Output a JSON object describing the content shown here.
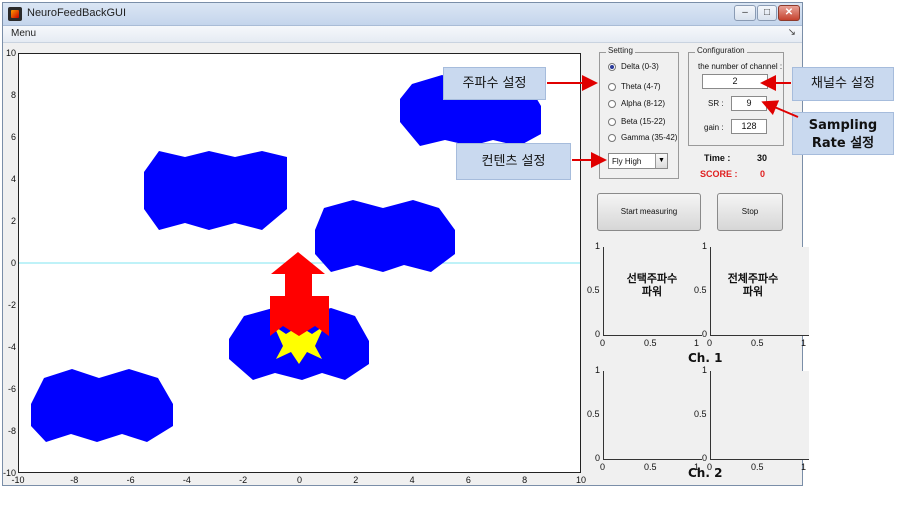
{
  "window": {
    "title": "NeuroFeedBackGUI",
    "min": "–",
    "max": "□",
    "close": "✕"
  },
  "menu": {
    "label": "Menu",
    "arrow": "↘"
  },
  "plot": {
    "yticks": [
      "10",
      "8",
      "6",
      "4",
      "2",
      "0",
      "-2",
      "-4",
      "-6",
      "-8",
      "-10"
    ],
    "xticks": [
      "-10",
      "-8",
      "-6",
      "-4",
      "-2",
      "0",
      "2",
      "4",
      "6",
      "8",
      "10"
    ],
    "baseline_color": "#7fe5f0",
    "obstacle_color": "#0000ff",
    "rocket_color": "#ff0000",
    "flame_color": "#ffff00"
  },
  "setting": {
    "title": "Setting",
    "options": [
      {
        "label": "Delta (0-3)",
        "selected": true
      },
      {
        "label": "Theta (4-7)",
        "selected": false
      },
      {
        "label": "Alpha (8-12)",
        "selected": false
      },
      {
        "label": "Beta (15-22)",
        "selected": false
      },
      {
        "label": "Gamma (35-42)",
        "selected": false
      }
    ],
    "content_value": "Fly High",
    "dropdown_arrow": "▼"
  },
  "configuration": {
    "title": "Configuration",
    "channel_label": "the number of channel :",
    "channel_value": "2",
    "sr_label": "SR :",
    "sr_value": "9",
    "gain_label": "gain :",
    "gain_value": "128"
  },
  "status": {
    "time_label": "Time :",
    "time_value": "30",
    "score_label": "SCORE :",
    "score_value": "0"
  },
  "buttons": {
    "start": "Start measuring",
    "stop": "Stop"
  },
  "mini_plots": {
    "yticks": [
      "1",
      "0.5",
      "0"
    ],
    "xticks": [
      "0",
      "0.5",
      "1"
    ],
    "selected_power": [
      "선택주파수",
      "파워"
    ],
    "total_power": [
      "전체주파수",
      "파워"
    ],
    "ch1": "Ch. 1",
    "ch2": "Ch. 2"
  },
  "annotations": {
    "frequency": "주파수 설정",
    "contents": "컨텐츠 설정",
    "channel": "채널수 설정",
    "sampling_line1": "Sampling",
    "sampling_line2": "Rate 설정",
    "arrow_color": "#e00000"
  }
}
